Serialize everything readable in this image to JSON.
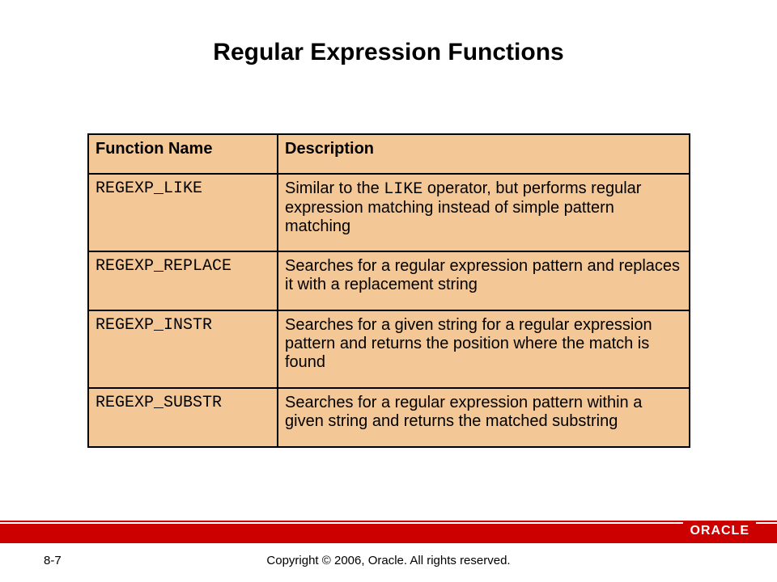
{
  "title": "Regular Expression Functions",
  "table": {
    "headers": {
      "fn": "Function Name",
      "desc": "Description"
    },
    "rows": [
      {
        "fn": "REGEXP_LIKE",
        "desc_pre": "Similar to the ",
        "desc_code": "LIKE",
        "desc_post": " operator, but performs regular expression matching instead of simple pattern matching"
      },
      {
        "fn": "REGEXP_REPLACE",
        "desc_pre": "Searches for a regular expression pattern and replaces it with a replacement string",
        "desc_code": "",
        "desc_post": ""
      },
      {
        "fn": "REGEXP_INSTR",
        "desc_pre": "Searches for a given string for a regular expression pattern and returns the position where the match is found",
        "desc_code": "",
        "desc_post": ""
      },
      {
        "fn": "REGEXP_SUBSTR",
        "desc_pre": "Searches for a regular expression pattern within a given string and returns the matched substring",
        "desc_code": "",
        "desc_post": ""
      }
    ]
  },
  "footer": {
    "page": "8-7",
    "copyright": "Copyright © 2006, Oracle. All rights reserved.",
    "logo": "ORACLE"
  }
}
